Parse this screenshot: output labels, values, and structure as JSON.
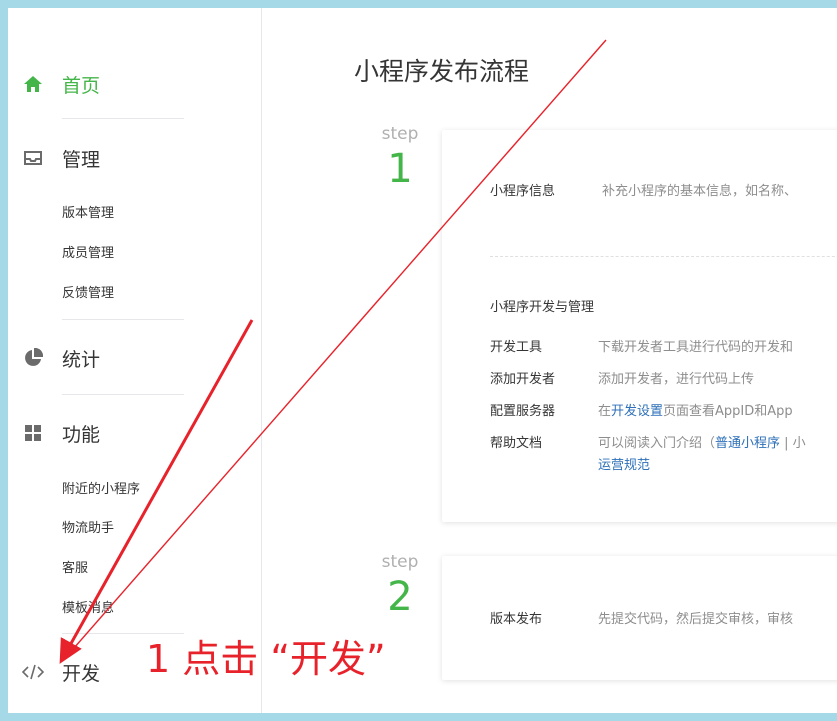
{
  "sidebar": {
    "home": {
      "label": "首页",
      "icon": "home-icon"
    },
    "manage": {
      "label": "管理",
      "icon": "inbox-icon",
      "items": [
        "版本管理",
        "成员管理",
        "反馈管理"
      ]
    },
    "stats": {
      "label": "统计",
      "icon": "pie-chart-icon"
    },
    "features": {
      "label": "功能",
      "icon": "grid-icon",
      "items": [
        "附近的小程序",
        "物流助手",
        "客服",
        "模板消息"
      ]
    },
    "dev": {
      "label": "开发",
      "icon": "code-icon"
    }
  },
  "main": {
    "title": "小程序发布流程",
    "step_label": "step",
    "steps": [
      {
        "number": "1",
        "info_label": "小程序信息",
        "info_desc": "补充小程序的基本信息，如名称、",
        "dev_section_title": "小程序开发与管理",
        "rows": [
          {
            "label": "开发工具",
            "desc": "下载开发者工具进行代码的开发和"
          },
          {
            "label": "添加开发者",
            "desc": "添加开发者，进行代码上传"
          },
          {
            "label": "配置服务器",
            "desc_prefix": "在",
            "desc_link": "开发设置",
            "desc_suffix": "页面查看AppID和App"
          },
          {
            "label": "帮助文档",
            "desc_prefix": "可以阅读入门介绍（",
            "desc_link": "普通小程序",
            "desc_suffix": " | 小",
            "desc_line2": "运营规范"
          }
        ]
      },
      {
        "number": "2",
        "info_label": "版本发布",
        "info_desc": "先提交代码，然后提交审核，审核"
      }
    ]
  },
  "annotation": {
    "text": "1 点击 “开发”",
    "color": "#e8222a"
  },
  "colors": {
    "accent": "#44b549",
    "link": "#2e70b8",
    "frame": "#a6d9e8"
  }
}
